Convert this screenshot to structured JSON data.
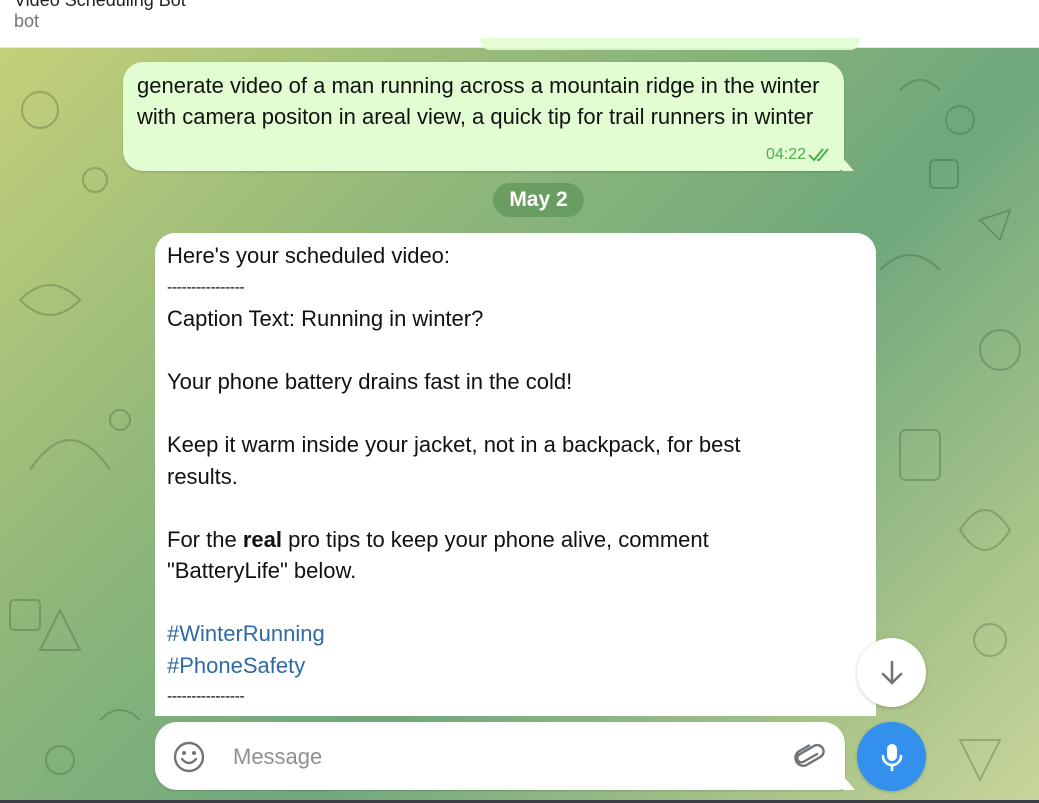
{
  "header": {
    "title": "Video Scheduling Bot",
    "subtitle": "bot"
  },
  "outgoing_message": {
    "text": "generate video of a man running across a mountain ridge in the winter with camera positon in areal view, a quick tip for trail runners in winter",
    "time": "04:22",
    "status_icon": "double-check-icon"
  },
  "date_separator": "May 2",
  "incoming_message": {
    "lines": {
      "l1": "Here's your scheduled video:",
      "l2": "----------------",
      "l3": "Caption Text: Running in winter?",
      "l4": "Your phone battery drains fast in the cold!",
      "l5a": "Keep it warm inside your jacket, not in a backpack, for best",
      "l5b": "results.",
      "l6_pre": "For the ",
      "l6_bold": "real",
      "l6_post": " pro tips to keep your phone alive, comment",
      "l6b": "\"BatteryLife\" below.",
      "tag1": "#WinterRunning",
      "tag2": "#PhoneSafety",
      "l7": "----------------"
    }
  },
  "composer": {
    "placeholder": "Message",
    "emoji_icon": "smile-icon",
    "attach_icon": "paperclip-icon",
    "send_icon": "microphone-icon"
  },
  "scroll_button_icon": "arrow-down-icon",
  "colors": {
    "outgoing_bubble": "#e2fdd2",
    "incoming_bubble": "#ffffff",
    "accent": "#3390ec",
    "hashtag": "#2f6aa5",
    "time_green": "#4fae4e"
  }
}
